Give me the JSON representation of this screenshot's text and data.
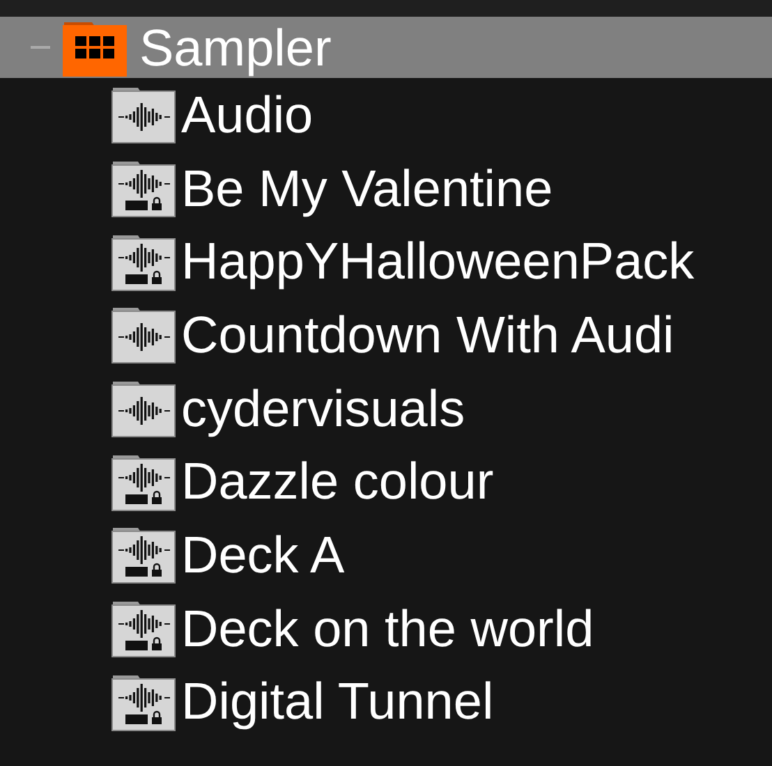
{
  "tree": {
    "label": "Sampler",
    "expanded": true,
    "selected": true,
    "children": [
      {
        "label": "Audio",
        "kind": "audio",
        "selected": false
      },
      {
        "label": "Be My Valentine",
        "kind": "zip",
        "selected": false
      },
      {
        "label": "HappYHalloweenPack",
        "kind": "zip",
        "selected": false
      },
      {
        "label": "Countdown With Audi",
        "kind": "audio",
        "selected": false
      },
      {
        "label": "cydervisuals",
        "kind": "audio",
        "selected": false
      },
      {
        "label": "Dazzle colour",
        "kind": "zip",
        "selected": false
      },
      {
        "label": "Deck A",
        "kind": "zip",
        "selected": false
      },
      {
        "label": "Deck on the world",
        "kind": "zip",
        "selected": false
      },
      {
        "label": "Digital Tunnel",
        "kind": "zip",
        "selected": false
      }
    ]
  }
}
